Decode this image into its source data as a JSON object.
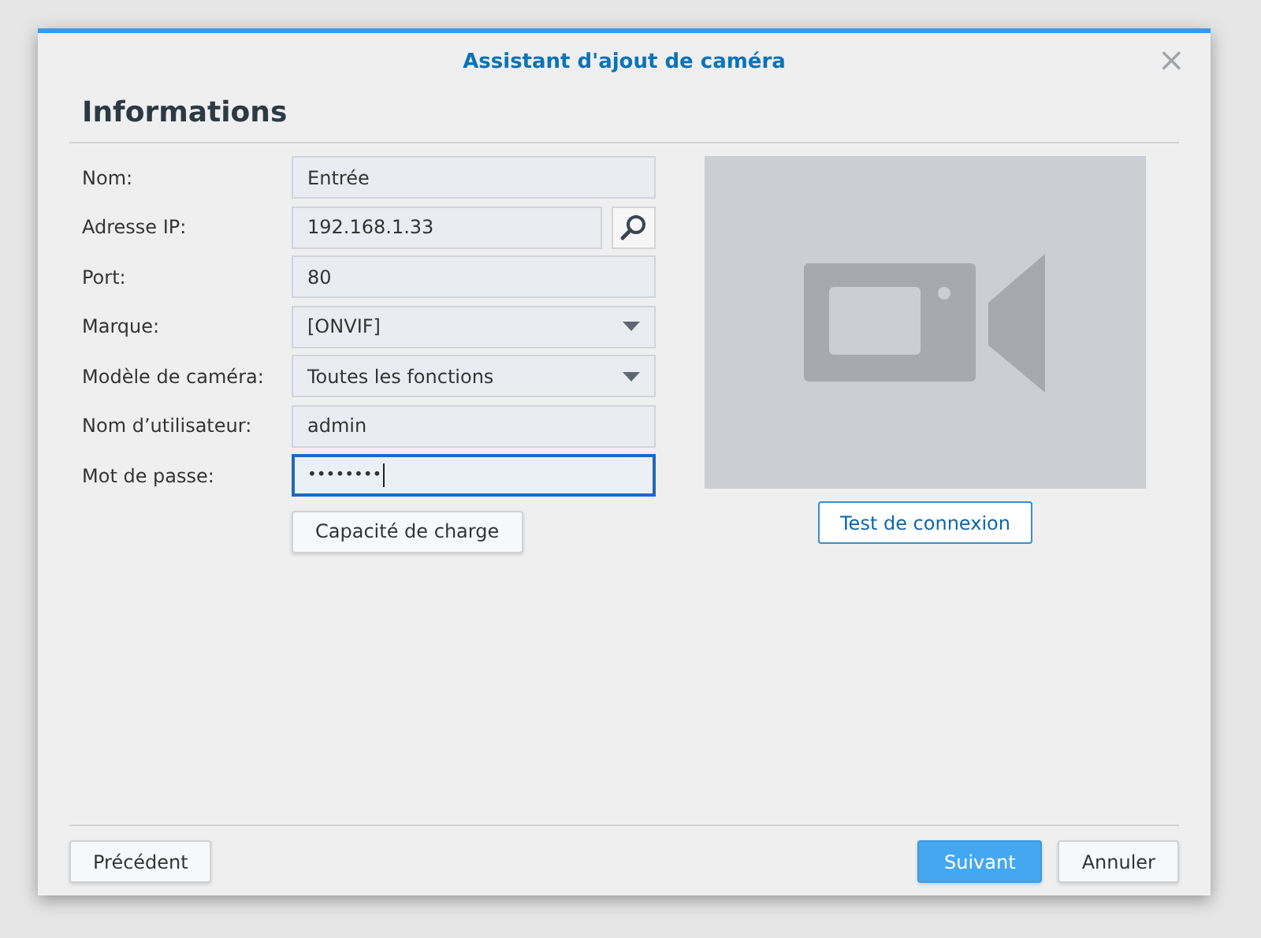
{
  "window": {
    "title": "Assistant d'ajout de caméra",
    "close": "×"
  },
  "heading": "Informations",
  "fields": [
    {
      "label": "Nom:",
      "kind": "text",
      "value": "Entrée",
      "focused": false
    },
    {
      "label": "Adresse IP:",
      "kind": "search",
      "value": "192.168.1.33",
      "focused": false
    },
    {
      "label": "Port:",
      "kind": "text",
      "value": "80",
      "focused": false
    },
    {
      "label": "Marque:",
      "kind": "select",
      "value": "[ONVIF]",
      "focused": false
    },
    {
      "label": "Modèle de caméra:",
      "kind": "select",
      "value": "Toutes les fonctions",
      "focused": false
    },
    {
      "label": "Nom d’utilisateur:",
      "kind": "text",
      "value": "admin",
      "focused": false
    },
    {
      "label": "Mot de passe:",
      "kind": "password",
      "value": "••••••••",
      "focused": true
    }
  ],
  "capacity_button": "Capacité de charge",
  "test_button": "Test de connexion",
  "footer": {
    "back": "Précédent",
    "next": "Suivant",
    "cancel": "Annuler"
  }
}
